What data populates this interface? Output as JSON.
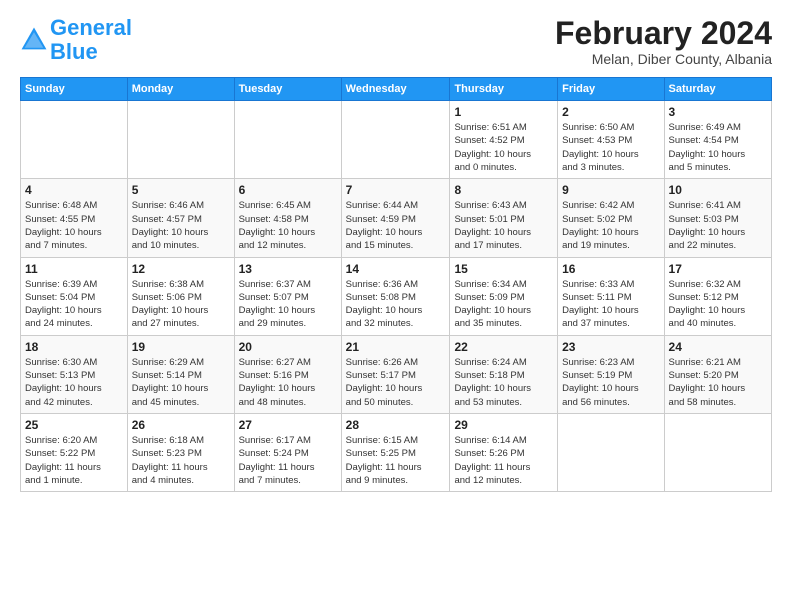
{
  "logo": {
    "line1": "General",
    "line2": "Blue"
  },
  "title": "February 2024",
  "location": "Melan, Diber County, Albania",
  "days_header": [
    "Sunday",
    "Monday",
    "Tuesday",
    "Wednesday",
    "Thursday",
    "Friday",
    "Saturday"
  ],
  "weeks": [
    [
      {
        "day": "",
        "info": ""
      },
      {
        "day": "",
        "info": ""
      },
      {
        "day": "",
        "info": ""
      },
      {
        "day": "",
        "info": ""
      },
      {
        "day": "1",
        "info": "Sunrise: 6:51 AM\nSunset: 4:52 PM\nDaylight: 10 hours\nand 0 minutes."
      },
      {
        "day": "2",
        "info": "Sunrise: 6:50 AM\nSunset: 4:53 PM\nDaylight: 10 hours\nand 3 minutes."
      },
      {
        "day": "3",
        "info": "Sunrise: 6:49 AM\nSunset: 4:54 PM\nDaylight: 10 hours\nand 5 minutes."
      }
    ],
    [
      {
        "day": "4",
        "info": "Sunrise: 6:48 AM\nSunset: 4:55 PM\nDaylight: 10 hours\nand 7 minutes."
      },
      {
        "day": "5",
        "info": "Sunrise: 6:46 AM\nSunset: 4:57 PM\nDaylight: 10 hours\nand 10 minutes."
      },
      {
        "day": "6",
        "info": "Sunrise: 6:45 AM\nSunset: 4:58 PM\nDaylight: 10 hours\nand 12 minutes."
      },
      {
        "day": "7",
        "info": "Sunrise: 6:44 AM\nSunset: 4:59 PM\nDaylight: 10 hours\nand 15 minutes."
      },
      {
        "day": "8",
        "info": "Sunrise: 6:43 AM\nSunset: 5:01 PM\nDaylight: 10 hours\nand 17 minutes."
      },
      {
        "day": "9",
        "info": "Sunrise: 6:42 AM\nSunset: 5:02 PM\nDaylight: 10 hours\nand 19 minutes."
      },
      {
        "day": "10",
        "info": "Sunrise: 6:41 AM\nSunset: 5:03 PM\nDaylight: 10 hours\nand 22 minutes."
      }
    ],
    [
      {
        "day": "11",
        "info": "Sunrise: 6:39 AM\nSunset: 5:04 PM\nDaylight: 10 hours\nand 24 minutes."
      },
      {
        "day": "12",
        "info": "Sunrise: 6:38 AM\nSunset: 5:06 PM\nDaylight: 10 hours\nand 27 minutes."
      },
      {
        "day": "13",
        "info": "Sunrise: 6:37 AM\nSunset: 5:07 PM\nDaylight: 10 hours\nand 29 minutes."
      },
      {
        "day": "14",
        "info": "Sunrise: 6:36 AM\nSunset: 5:08 PM\nDaylight: 10 hours\nand 32 minutes."
      },
      {
        "day": "15",
        "info": "Sunrise: 6:34 AM\nSunset: 5:09 PM\nDaylight: 10 hours\nand 35 minutes."
      },
      {
        "day": "16",
        "info": "Sunrise: 6:33 AM\nSunset: 5:11 PM\nDaylight: 10 hours\nand 37 minutes."
      },
      {
        "day": "17",
        "info": "Sunrise: 6:32 AM\nSunset: 5:12 PM\nDaylight: 10 hours\nand 40 minutes."
      }
    ],
    [
      {
        "day": "18",
        "info": "Sunrise: 6:30 AM\nSunset: 5:13 PM\nDaylight: 10 hours\nand 42 minutes."
      },
      {
        "day": "19",
        "info": "Sunrise: 6:29 AM\nSunset: 5:14 PM\nDaylight: 10 hours\nand 45 minutes."
      },
      {
        "day": "20",
        "info": "Sunrise: 6:27 AM\nSunset: 5:16 PM\nDaylight: 10 hours\nand 48 minutes."
      },
      {
        "day": "21",
        "info": "Sunrise: 6:26 AM\nSunset: 5:17 PM\nDaylight: 10 hours\nand 50 minutes."
      },
      {
        "day": "22",
        "info": "Sunrise: 6:24 AM\nSunset: 5:18 PM\nDaylight: 10 hours\nand 53 minutes."
      },
      {
        "day": "23",
        "info": "Sunrise: 6:23 AM\nSunset: 5:19 PM\nDaylight: 10 hours\nand 56 minutes."
      },
      {
        "day": "24",
        "info": "Sunrise: 6:21 AM\nSunset: 5:20 PM\nDaylight: 10 hours\nand 58 minutes."
      }
    ],
    [
      {
        "day": "25",
        "info": "Sunrise: 6:20 AM\nSunset: 5:22 PM\nDaylight: 11 hours\nand 1 minute."
      },
      {
        "day": "26",
        "info": "Sunrise: 6:18 AM\nSunset: 5:23 PM\nDaylight: 11 hours\nand 4 minutes."
      },
      {
        "day": "27",
        "info": "Sunrise: 6:17 AM\nSunset: 5:24 PM\nDaylight: 11 hours\nand 7 minutes."
      },
      {
        "day": "28",
        "info": "Sunrise: 6:15 AM\nSunset: 5:25 PM\nDaylight: 11 hours\nand 9 minutes."
      },
      {
        "day": "29",
        "info": "Sunrise: 6:14 AM\nSunset: 5:26 PM\nDaylight: 11 hours\nand 12 minutes."
      },
      {
        "day": "",
        "info": ""
      },
      {
        "day": "",
        "info": ""
      }
    ]
  ]
}
